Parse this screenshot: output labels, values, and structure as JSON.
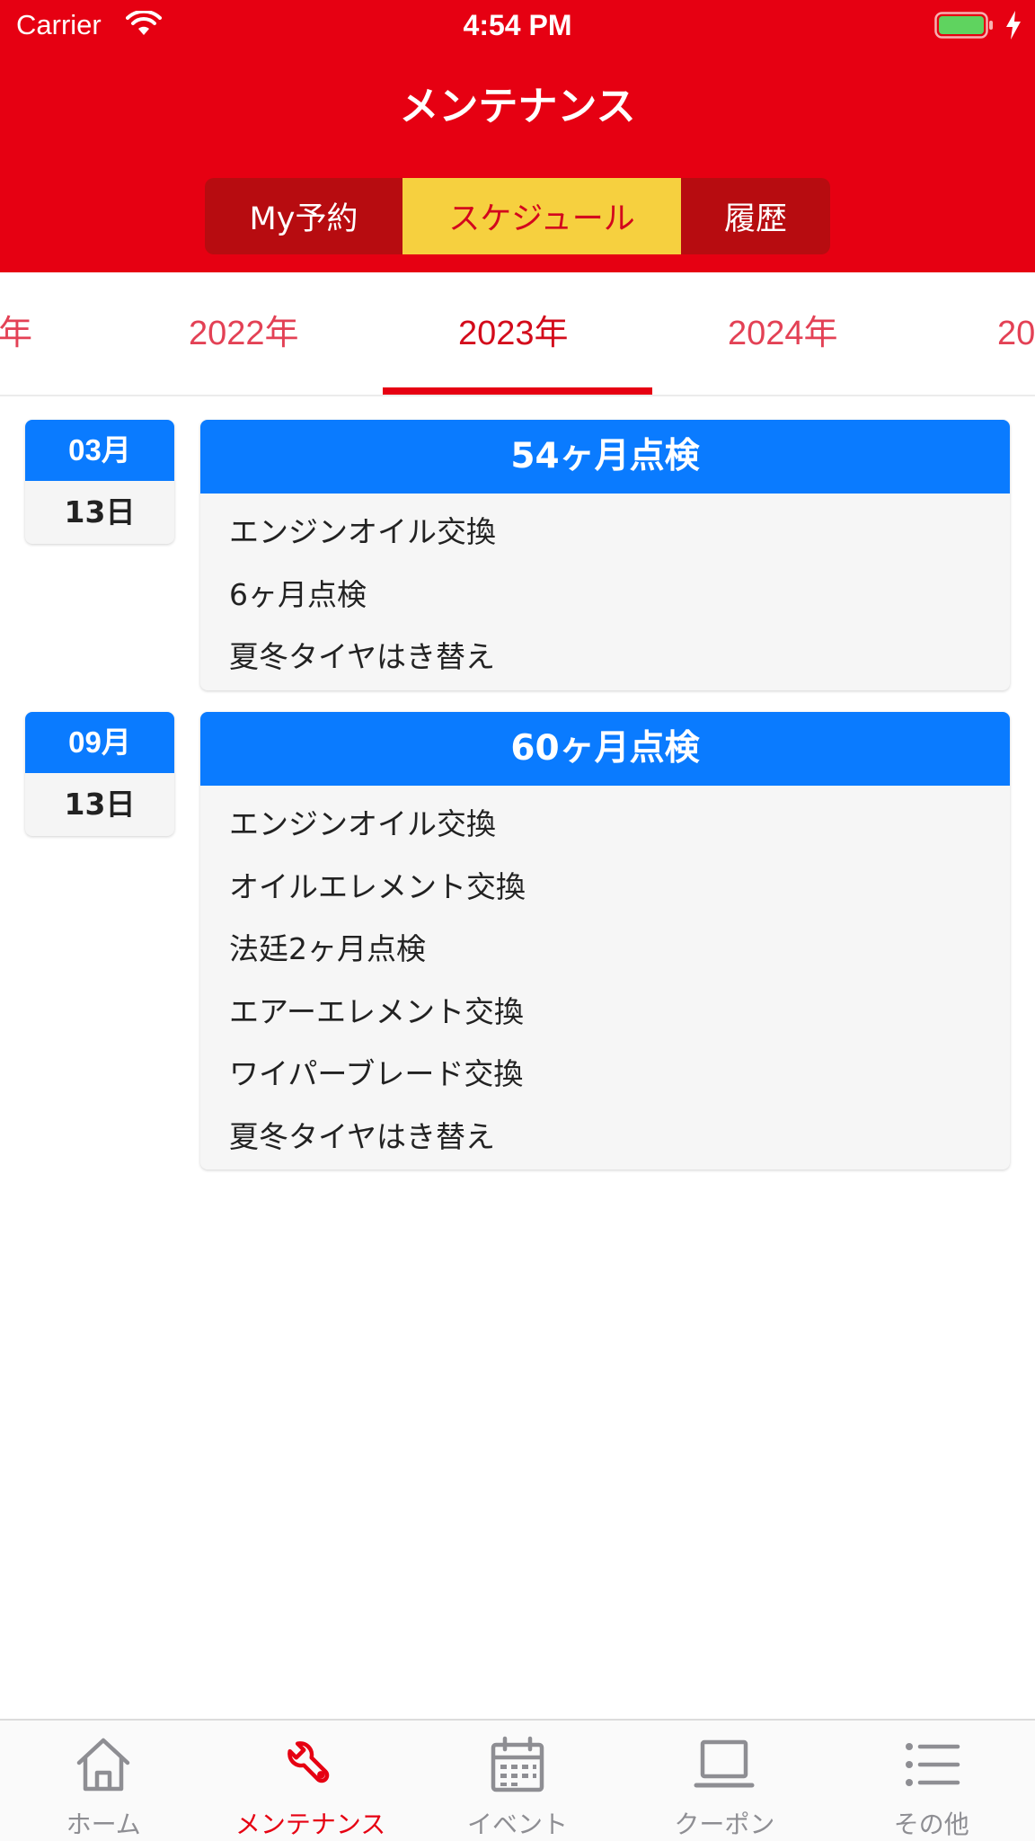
{
  "status_bar": {
    "carrier": "Carrier",
    "time": "4:54 PM"
  },
  "header": {
    "title": "メンテナンス",
    "segments": [
      {
        "label": "My予約",
        "selected": false
      },
      {
        "label": "スケジュール",
        "selected": true
      },
      {
        "label": "履歴",
        "selected": false
      }
    ]
  },
  "year_tabs": [
    {
      "label": "年",
      "selected": false
    },
    {
      "label": "2022年",
      "selected": false
    },
    {
      "label": "2023年",
      "selected": true
    },
    {
      "label": "2024年",
      "selected": false
    },
    {
      "label": "20",
      "selected": false
    }
  ],
  "schedule": [
    {
      "month": "03月",
      "day": "13日",
      "title": "54ヶ月点検",
      "items": [
        "エンジンオイル交換",
        "6ヶ月点検",
        "夏冬タイヤはき替え"
      ]
    },
    {
      "month": "09月",
      "day": "13日",
      "title": "60ヶ月点検",
      "items": [
        "エンジンオイル交換",
        "オイルエレメント交換",
        "法廷2ヶ月点検",
        "エアーエレメント交換",
        "ワイパーブレード交換",
        "夏冬タイヤはき替え"
      ]
    }
  ],
  "tab_bar": [
    {
      "label": "ホーム",
      "icon": "home-icon",
      "active": false
    },
    {
      "label": "メンテナンス",
      "icon": "wrench-icon",
      "active": true
    },
    {
      "label": "イベント",
      "icon": "calendar-icon",
      "active": false
    },
    {
      "label": "クーポン",
      "icon": "laptop-icon",
      "active": false
    },
    {
      "label": "その他",
      "icon": "list-icon",
      "active": false
    }
  ],
  "colors": {
    "brand_red": "#e60012",
    "segment_dark": "#b70c10",
    "segment_selected": "#f6d03f",
    "accent_blue": "#0a7bff",
    "tab_inactive": "#8e8e93"
  }
}
